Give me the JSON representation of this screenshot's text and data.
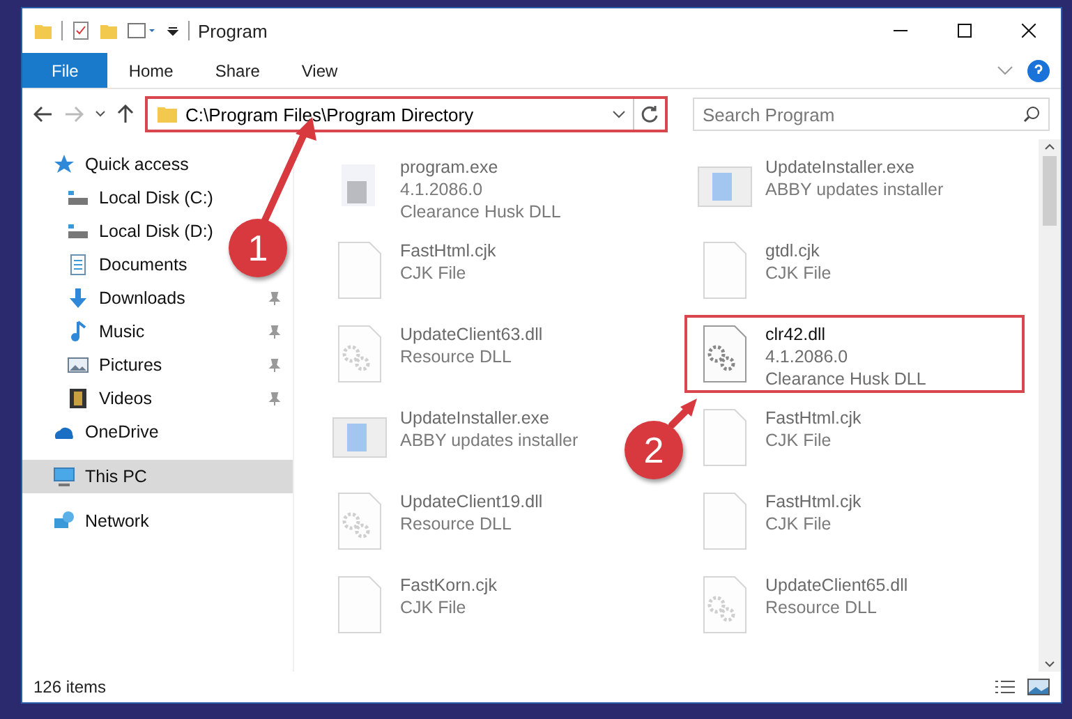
{
  "window": {
    "title": "Program"
  },
  "ribbon": {
    "tabs": [
      {
        "label": "File",
        "selected": true
      },
      {
        "label": "Home",
        "selected": false
      },
      {
        "label": "Share",
        "selected": false
      },
      {
        "label": "View",
        "selected": false
      }
    ]
  },
  "address": {
    "path": "C:\\Program Files\\Program Directory",
    "highlighted": true
  },
  "search": {
    "placeholder": "Search Program"
  },
  "sidebar": {
    "items": [
      {
        "label": "Quick access",
        "kind": "star",
        "selected": false,
        "pinned": false,
        "children": [
          {
            "label": "Local Disk (C:)",
            "kind": "drive",
            "selected": false,
            "pinned": false
          },
          {
            "label": "Local Disk (D:)",
            "kind": "drive",
            "selected": false,
            "pinned": false
          },
          {
            "label": "Documents",
            "kind": "docs",
            "selected": false,
            "pinned": false
          },
          {
            "label": "Downloads",
            "kind": "download",
            "selected": false,
            "pinned": true
          },
          {
            "label": "Music",
            "kind": "music",
            "selected": false,
            "pinned": true
          },
          {
            "label": "Pictures",
            "kind": "pictures",
            "selected": false,
            "pinned": true
          },
          {
            "label": "Videos",
            "kind": "videos",
            "selected": false,
            "pinned": true
          }
        ]
      },
      {
        "label": "OneDrive",
        "kind": "cloud",
        "selected": false,
        "pinned": false
      },
      {
        "label": "This PC",
        "kind": "pc",
        "selected": true,
        "pinned": false
      },
      {
        "label": "Network",
        "kind": "network",
        "selected": false,
        "pinned": false
      }
    ]
  },
  "files": [
    {
      "name": "program.exe",
      "lines": [
        "4.1.2086.0",
        "Clearance Husk DLL"
      ],
      "kind": "exe",
      "faded": true,
      "highlighted": false
    },
    {
      "name": "UpdateInstaller.exe",
      "lines": [
        "ABBY updates installer"
      ],
      "kind": "installer",
      "faded": true,
      "highlighted": false
    },
    {
      "name": "FastHtml.cjk",
      "lines": [
        "CJK File"
      ],
      "kind": "blank",
      "faded": true,
      "highlighted": false
    },
    {
      "name": "gtdl.cjk",
      "lines": [
        "CJK File"
      ],
      "kind": "blank",
      "faded": true,
      "highlighted": false
    },
    {
      "name": "UpdateClient63.dll",
      "lines": [
        "Resource DLL"
      ],
      "kind": "dll",
      "faded": true,
      "highlighted": false
    },
    {
      "name": "clr42.dll",
      "lines": [
        "4.1.2086.0",
        "Clearance Husk DLL"
      ],
      "kind": "dll",
      "faded": false,
      "highlighted": true
    },
    {
      "name": "UpdateInstaller.exe",
      "lines": [
        "ABBY updates installer"
      ],
      "kind": "installer",
      "faded": true,
      "highlighted": false
    },
    {
      "name": "FastHtml.cjk",
      "lines": [
        "CJK File"
      ],
      "kind": "blank",
      "faded": true,
      "highlighted": false
    },
    {
      "name": "UpdateClient19.dll",
      "lines": [
        "Resource DLL"
      ],
      "kind": "dll",
      "faded": true,
      "highlighted": false
    },
    {
      "name": "FastHtml.cjk",
      "lines": [
        "CJK File"
      ],
      "kind": "blank",
      "faded": true,
      "highlighted": false
    },
    {
      "name": "FastKorn.cjk",
      "lines": [
        "CJK File"
      ],
      "kind": "blank",
      "faded": true,
      "highlighted": false
    },
    {
      "name": "UpdateClient65.dll",
      "lines": [
        "Resource DLL"
      ],
      "kind": "dll",
      "faded": true,
      "highlighted": false
    }
  ],
  "status_bar": {
    "count": "126 items"
  },
  "annotations": [
    {
      "label": "1"
    },
    {
      "label": "2"
    }
  ]
}
